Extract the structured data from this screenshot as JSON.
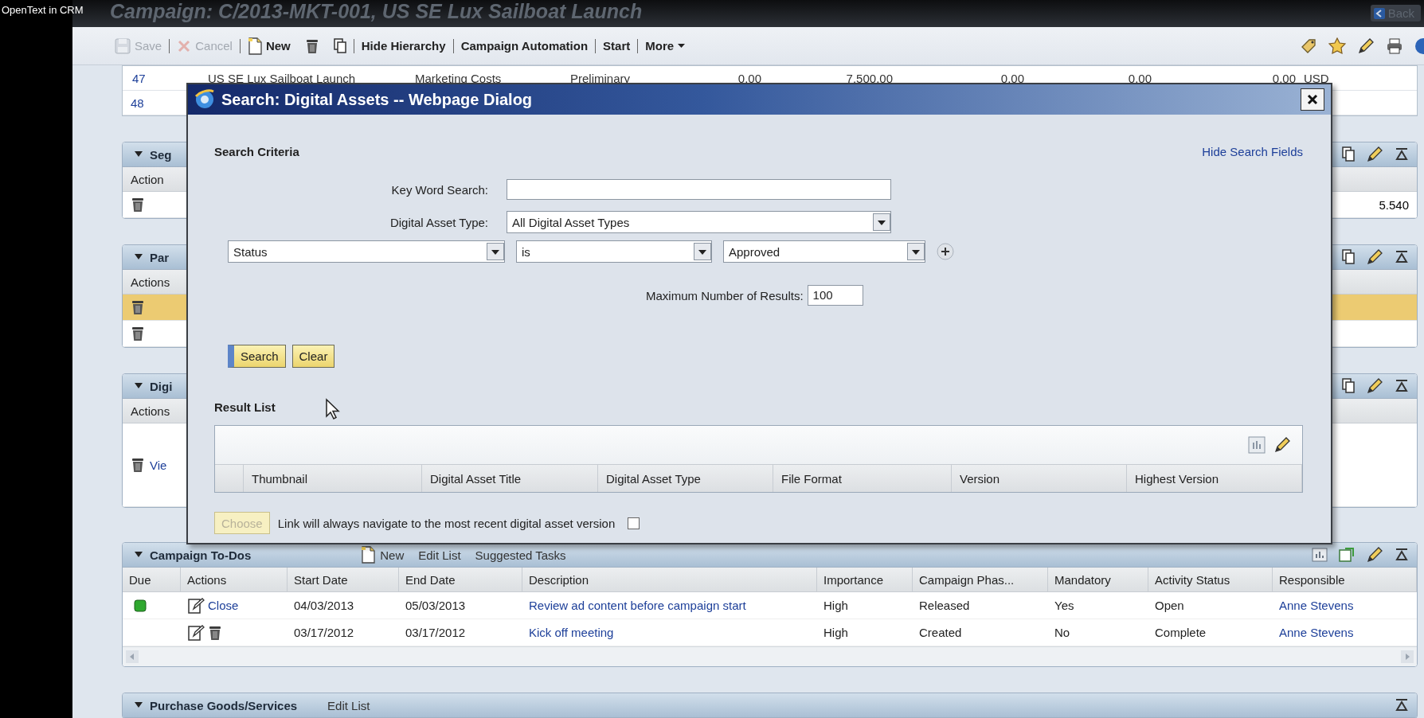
{
  "overlay_caption": "OpenText in CRM",
  "page": {
    "title": "Campaign: C/2013-MKT-001, US SE Lux Sailboat Launch",
    "back": "Back"
  },
  "toolbar": [
    {
      "kind": "save",
      "label": "Save",
      "disabled": true
    },
    {
      "kind": "cancel",
      "label": "Cancel",
      "disabled": true
    },
    {
      "kind": "new",
      "label": "New",
      "disabled": false
    },
    {
      "kind": "delete",
      "disabled": false
    },
    {
      "kind": "copy",
      "disabled": false
    },
    {
      "kind": "plain",
      "label": "Hide Hierarchy",
      "disabled": false
    },
    {
      "kind": "plain",
      "label": "Campaign Automation",
      "disabled": false
    },
    {
      "kind": "plain",
      "label": "Start",
      "disabled": false
    },
    {
      "kind": "menu",
      "label": "More",
      "disabled": false
    }
  ],
  "hierarchy_rows": [
    {
      "cells": [
        "47",
        "US SE Lux Sailboat Launch",
        "Marketing Costs",
        "Preliminary",
        "0.00",
        "7,500.00",
        "0.00",
        "0.00",
        "0.00",
        "USD"
      ]
    },
    {
      "cells": [
        "48"
      ]
    }
  ],
  "panels": [
    {
      "title": "Seg",
      "column": "Action",
      "rows": [
        {
          "selected": false,
          "value": "5.540"
        }
      ]
    },
    {
      "title": "Par",
      "column": "Actions",
      "rows": [
        {
          "selected": true
        },
        {
          "selected": false
        }
      ]
    },
    {
      "title": "Digi",
      "column": "Actions",
      "rows": [
        {
          "selected": false,
          "link": "Vie"
        }
      ]
    }
  ],
  "dialog": {
    "title": "Search: Digital Assets -- Webpage Dialog",
    "section": "Search Criteria",
    "hide_link": "Hide Search Fields",
    "keyword": {
      "label": "Key Word Search:"
    },
    "asset_type": {
      "label": "Digital Asset Type:",
      "value": "All Digital Asset Types"
    },
    "criterion": {
      "field": "Status",
      "operator": "is",
      "value": "Approved"
    },
    "max_results": {
      "label": "Maximum Number of Results:",
      "value": "100"
    },
    "buttons": [
      {
        "label": "Search",
        "focused": true
      },
      {
        "label": "Clear",
        "focused": false
      }
    ],
    "result_list": {
      "title": "Result List",
      "columns": [
        "Thumbnail",
        "Digital Asset Title",
        "Digital Asset Type",
        "File Format",
        "Version",
        "Highest Version"
      ]
    },
    "choose": {
      "label": "Choose",
      "disabled": true
    },
    "link_option": {
      "label": "Link will always navigate to the most recent digital asset version",
      "checked": false
    }
  },
  "todos": {
    "title": "Campaign To-Dos",
    "actions": [
      {
        "kind": "new",
        "label": "New"
      },
      {
        "kind": "plain",
        "label": "Edit List"
      },
      {
        "kind": "plain",
        "label": "Suggested Tasks"
      }
    ],
    "columns": [
      "Due",
      "Actions",
      "Start Date",
      "End Date",
      "Description",
      "Importance",
      "Campaign Phas...",
      "Mandatory",
      "Activity Status",
      "Responsible"
    ],
    "rows": [
      {
        "due_light": true,
        "actions": [
          {
            "kind": "edit"
          },
          {
            "kind": "close",
            "label": "Close"
          }
        ],
        "start_date": "04/03/2013",
        "end_date": "05/03/2013",
        "description": "Review ad content before campaign start",
        "importance": "High",
        "phase": "Released",
        "mandatory": "Yes",
        "activity_status": "Open",
        "responsible": "Anne Stevens"
      },
      {
        "due_light": false,
        "actions": [
          {
            "kind": "edit"
          },
          {
            "kind": "delete"
          }
        ],
        "start_date": "03/17/2012",
        "end_date": "03/17/2012",
        "description": "Kick off meeting",
        "importance": "High",
        "phase": "Created",
        "mandatory": "No",
        "activity_status": "Complete",
        "responsible": "Anne Stevens"
      }
    ]
  },
  "purchase": {
    "title": "Purchase Goods/Services",
    "actions": [
      "Edit List"
    ]
  }
}
